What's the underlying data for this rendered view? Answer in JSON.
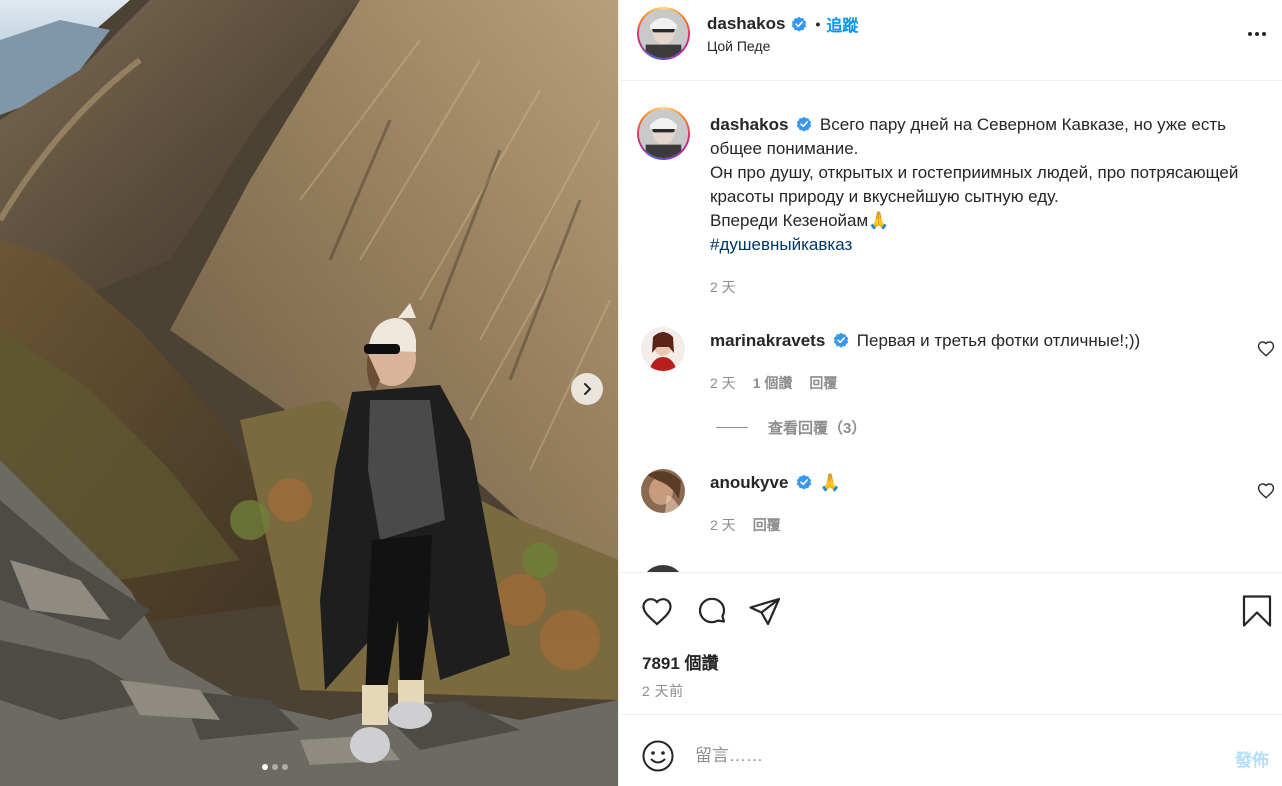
{
  "post": {
    "author": "dashakos",
    "verified": true,
    "follow_label": "追蹤",
    "separator": "•",
    "location": "Цой Педе",
    "more_icon": "more-horizontal-icon",
    "photo": {
      "description_icon": "mountain-photo",
      "carousel_dots": 3,
      "active_dot": 1
    }
  },
  "caption": {
    "username": "dashakos",
    "lines": [
      "Всего пару дней на Северном Кавказе, но уже есть общее понимание.",
      "Он про душу, открытых и гостеприимных людей, про потрясающей красоты природу и вкуснейшую сытную еду.",
      "Впереди Кезенойам🙏"
    ],
    "hashtag": "#душевныйкавказ",
    "time": "2 天"
  },
  "comments": [
    {
      "username": "marinakravets",
      "verified": true,
      "text": "Первая и третья фотки отличные!;))",
      "time": "2 天",
      "likes": "1 個讚",
      "reply": "回覆"
    },
    {
      "username": "anoukyve",
      "verified": true,
      "text": "🙏",
      "time": "2 天",
      "reply": "回覆"
    }
  ],
  "view_replies": "查看回覆（3）",
  "actions": {
    "likes": "7891 個讚",
    "posted": "2 天前"
  },
  "composer": {
    "placeholder": "留言……",
    "post_label": "發佈"
  },
  "colors": {
    "link_blue": "#0095f6",
    "hashtag": "#00376b",
    "muted": "#8e8e8e",
    "text": "#262626",
    "post_disabled": "#b2dffc",
    "verified": "#3897f0"
  }
}
